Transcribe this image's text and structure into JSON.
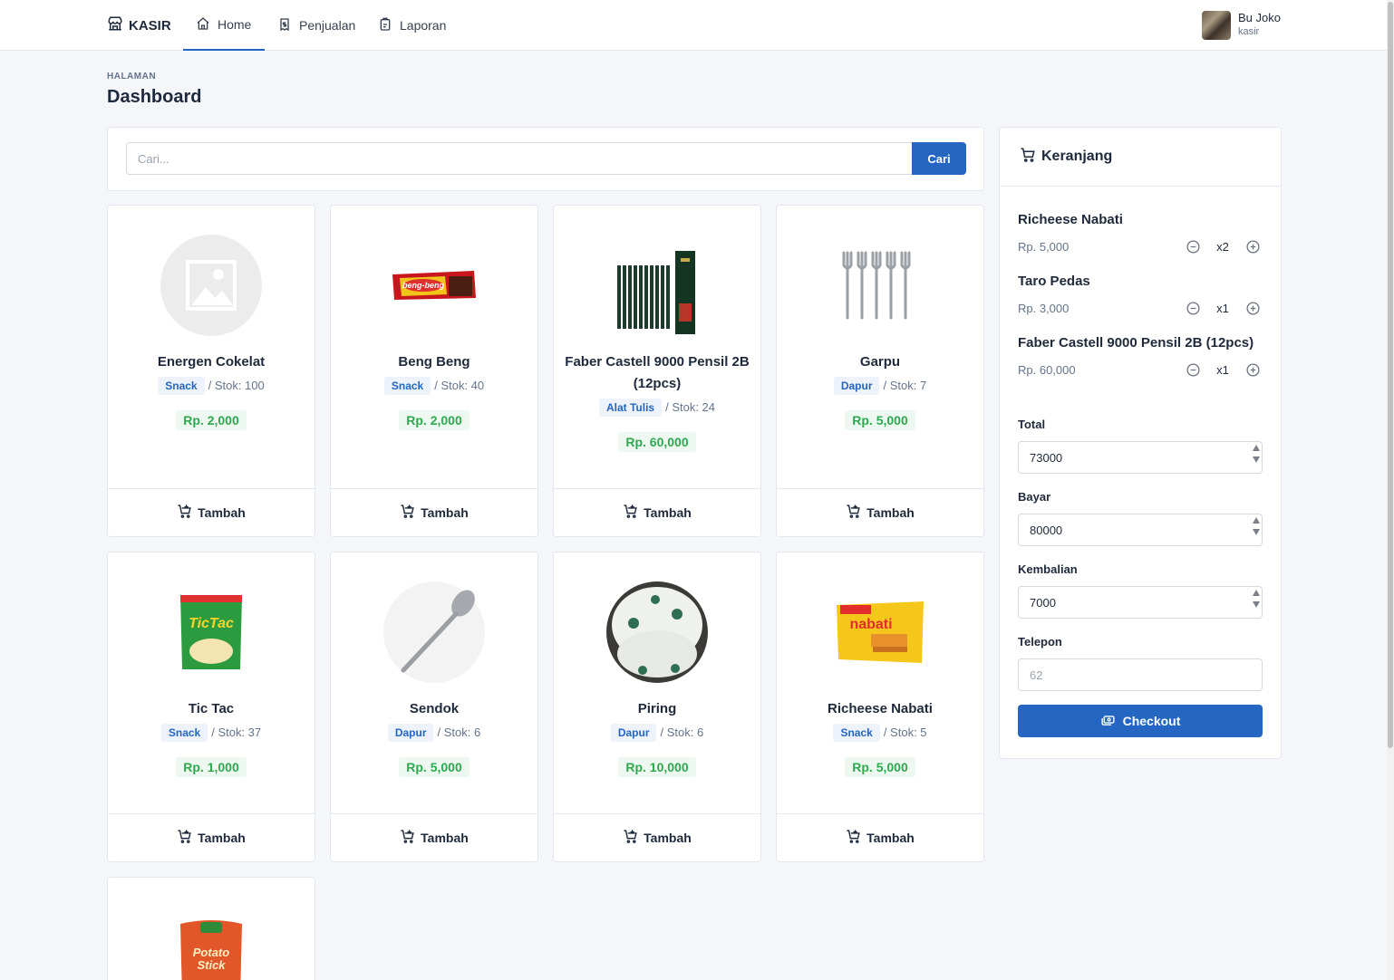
{
  "nav": {
    "brand": "KASIR",
    "links": [
      {
        "label": "Home",
        "icon": "home-icon",
        "active": true
      },
      {
        "label": "Penjualan",
        "icon": "receipt-icon",
        "active": false
      },
      {
        "label": "Laporan",
        "icon": "report-icon",
        "active": false
      }
    ],
    "user": {
      "name": "Bu Joko",
      "role": "kasir"
    }
  },
  "page": {
    "pretitle": "HALAMAN",
    "title": "Dashboard"
  },
  "search": {
    "placeholder": "Cari...",
    "value": "",
    "button": "Cari"
  },
  "products": [
    {
      "name": "Energen Cokelat",
      "category": "Snack",
      "stock": "/ Stok: 100",
      "price": "Rp. 2,000",
      "image": "placeholder-image",
      "add_label": "Tambah"
    },
    {
      "name": "Beng Beng",
      "category": "Snack",
      "stock": "/ Stok: 40",
      "price": "Rp. 2,000",
      "image": "chocolate-bar-image",
      "add_label": "Tambah"
    },
    {
      "name": "Faber Castell 9000 Pensil 2B (12pcs)",
      "category": "Alat Tulis",
      "stock": "/ Stok: 24",
      "price": "Rp. 60,000",
      "image": "pencils-image",
      "add_label": "Tambah"
    },
    {
      "name": "Garpu",
      "category": "Dapur",
      "stock": "/ Stok: 7",
      "price": "Rp. 5,000",
      "image": "forks-image",
      "add_label": "Tambah"
    },
    {
      "name": "Tic Tac",
      "category": "Snack",
      "stock": "/ Stok: 37",
      "price": "Rp. 1,000",
      "image": "snack-bag-image",
      "add_label": "Tambah"
    },
    {
      "name": "Sendok",
      "category": "Dapur",
      "stock": "/ Stok: 6",
      "price": "Rp. 5,000",
      "image": "spoon-image",
      "add_label": "Tambah"
    },
    {
      "name": "Piring",
      "category": "Dapur",
      "stock": "/ Stok: 6",
      "price": "Rp. 10,000",
      "image": "plate-image",
      "add_label": "Tambah"
    },
    {
      "name": "Richeese Nabati",
      "category": "Snack",
      "stock": "/ Stok: 5",
      "price": "Rp. 5,000",
      "image": "wafer-pack-image",
      "add_label": "Tambah"
    },
    {
      "name": "",
      "category": "",
      "stock": "",
      "price": "",
      "image": "potato-stick-image",
      "add_label": ""
    }
  ],
  "cart": {
    "title": "Keranjang",
    "items": [
      {
        "name": "Richeese Nabati",
        "price": "Rp. 5,000",
        "qty": "x2"
      },
      {
        "name": "Taro Pedas",
        "price": "Rp. 3,000",
        "qty": "x1"
      },
      {
        "name": "Faber Castell 9000 Pensil 2B (12pcs)",
        "price": "Rp. 60,000",
        "qty": "x1"
      }
    ],
    "total_label": "Total",
    "total": "73000",
    "bayar_label": "Bayar",
    "bayar": "80000",
    "kembalian_label": "Kembalian",
    "kembalian": "7000",
    "telepon_label": "Telepon",
    "telepon_placeholder": "62",
    "checkout_label": "Checkout"
  },
  "colors": {
    "primary": "#2466c2",
    "price_green": "#2fa84f",
    "badge_bg": "#eef3fb",
    "background": "#f4f6fa"
  }
}
